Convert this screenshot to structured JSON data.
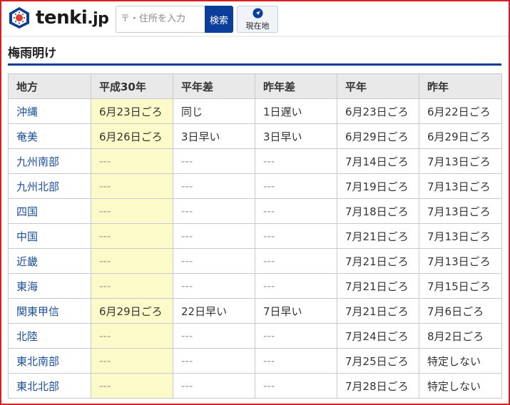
{
  "header": {
    "logo_text": "tenki",
    "logo_suffix": ".jp",
    "search_placeholder": "〒・住所を入力",
    "search_button_label": "検索",
    "location_button_label": "現在地"
  },
  "page_title": "梅雨明け",
  "table": {
    "columns": [
      "地方",
      "平成30年",
      "平年差",
      "昨年差",
      "平年",
      "昨年"
    ],
    "rows": [
      [
        "沖縄",
        "6月23日ごろ",
        "同じ",
        "1日遅い",
        "6月23日ごろ",
        "6月22日ごろ"
      ],
      [
        "奄美",
        "6月26日ごろ",
        "3日早い",
        "3日早い",
        "6月29日ごろ",
        "6月29日ごろ"
      ],
      [
        "九州南部",
        "---",
        "---",
        "---",
        "7月14日ごろ",
        "7月13日ごろ"
      ],
      [
        "九州北部",
        "---",
        "---",
        "---",
        "7月19日ごろ",
        "7月13日ごろ"
      ],
      [
        "四国",
        "---",
        "---",
        "---",
        "7月18日ごろ",
        "7月13日ごろ"
      ],
      [
        "中国",
        "---",
        "---",
        "---",
        "7月21日ごろ",
        "7月13日ごろ"
      ],
      [
        "近畿",
        "---",
        "---",
        "---",
        "7月21日ごろ",
        "7月13日ごろ"
      ],
      [
        "東海",
        "---",
        "---",
        "---",
        "7月21日ごろ",
        "7月15日ごろ"
      ],
      [
        "関東甲信",
        "6月29日ごろ",
        "22日早い",
        "7日早い",
        "7月21日ごろ",
        "7月6日ごろ"
      ],
      [
        "北陸",
        "---",
        "---",
        "---",
        "7月24日ごろ",
        "8月2日ごろ"
      ],
      [
        "東北南部",
        "---",
        "---",
        "---",
        "7月25日ごろ",
        "特定しない"
      ],
      [
        "東北北部",
        "---",
        "---",
        "---",
        "7月28日ごろ",
        "特定しない"
      ]
    ]
  },
  "colors": {
    "brand_blue": "#0b3e9b",
    "link_blue": "#1b4f9c",
    "highlight_yellow": "#fcfac8",
    "header_gray": "#e9e9e9",
    "frame_red": "#d42020"
  }
}
